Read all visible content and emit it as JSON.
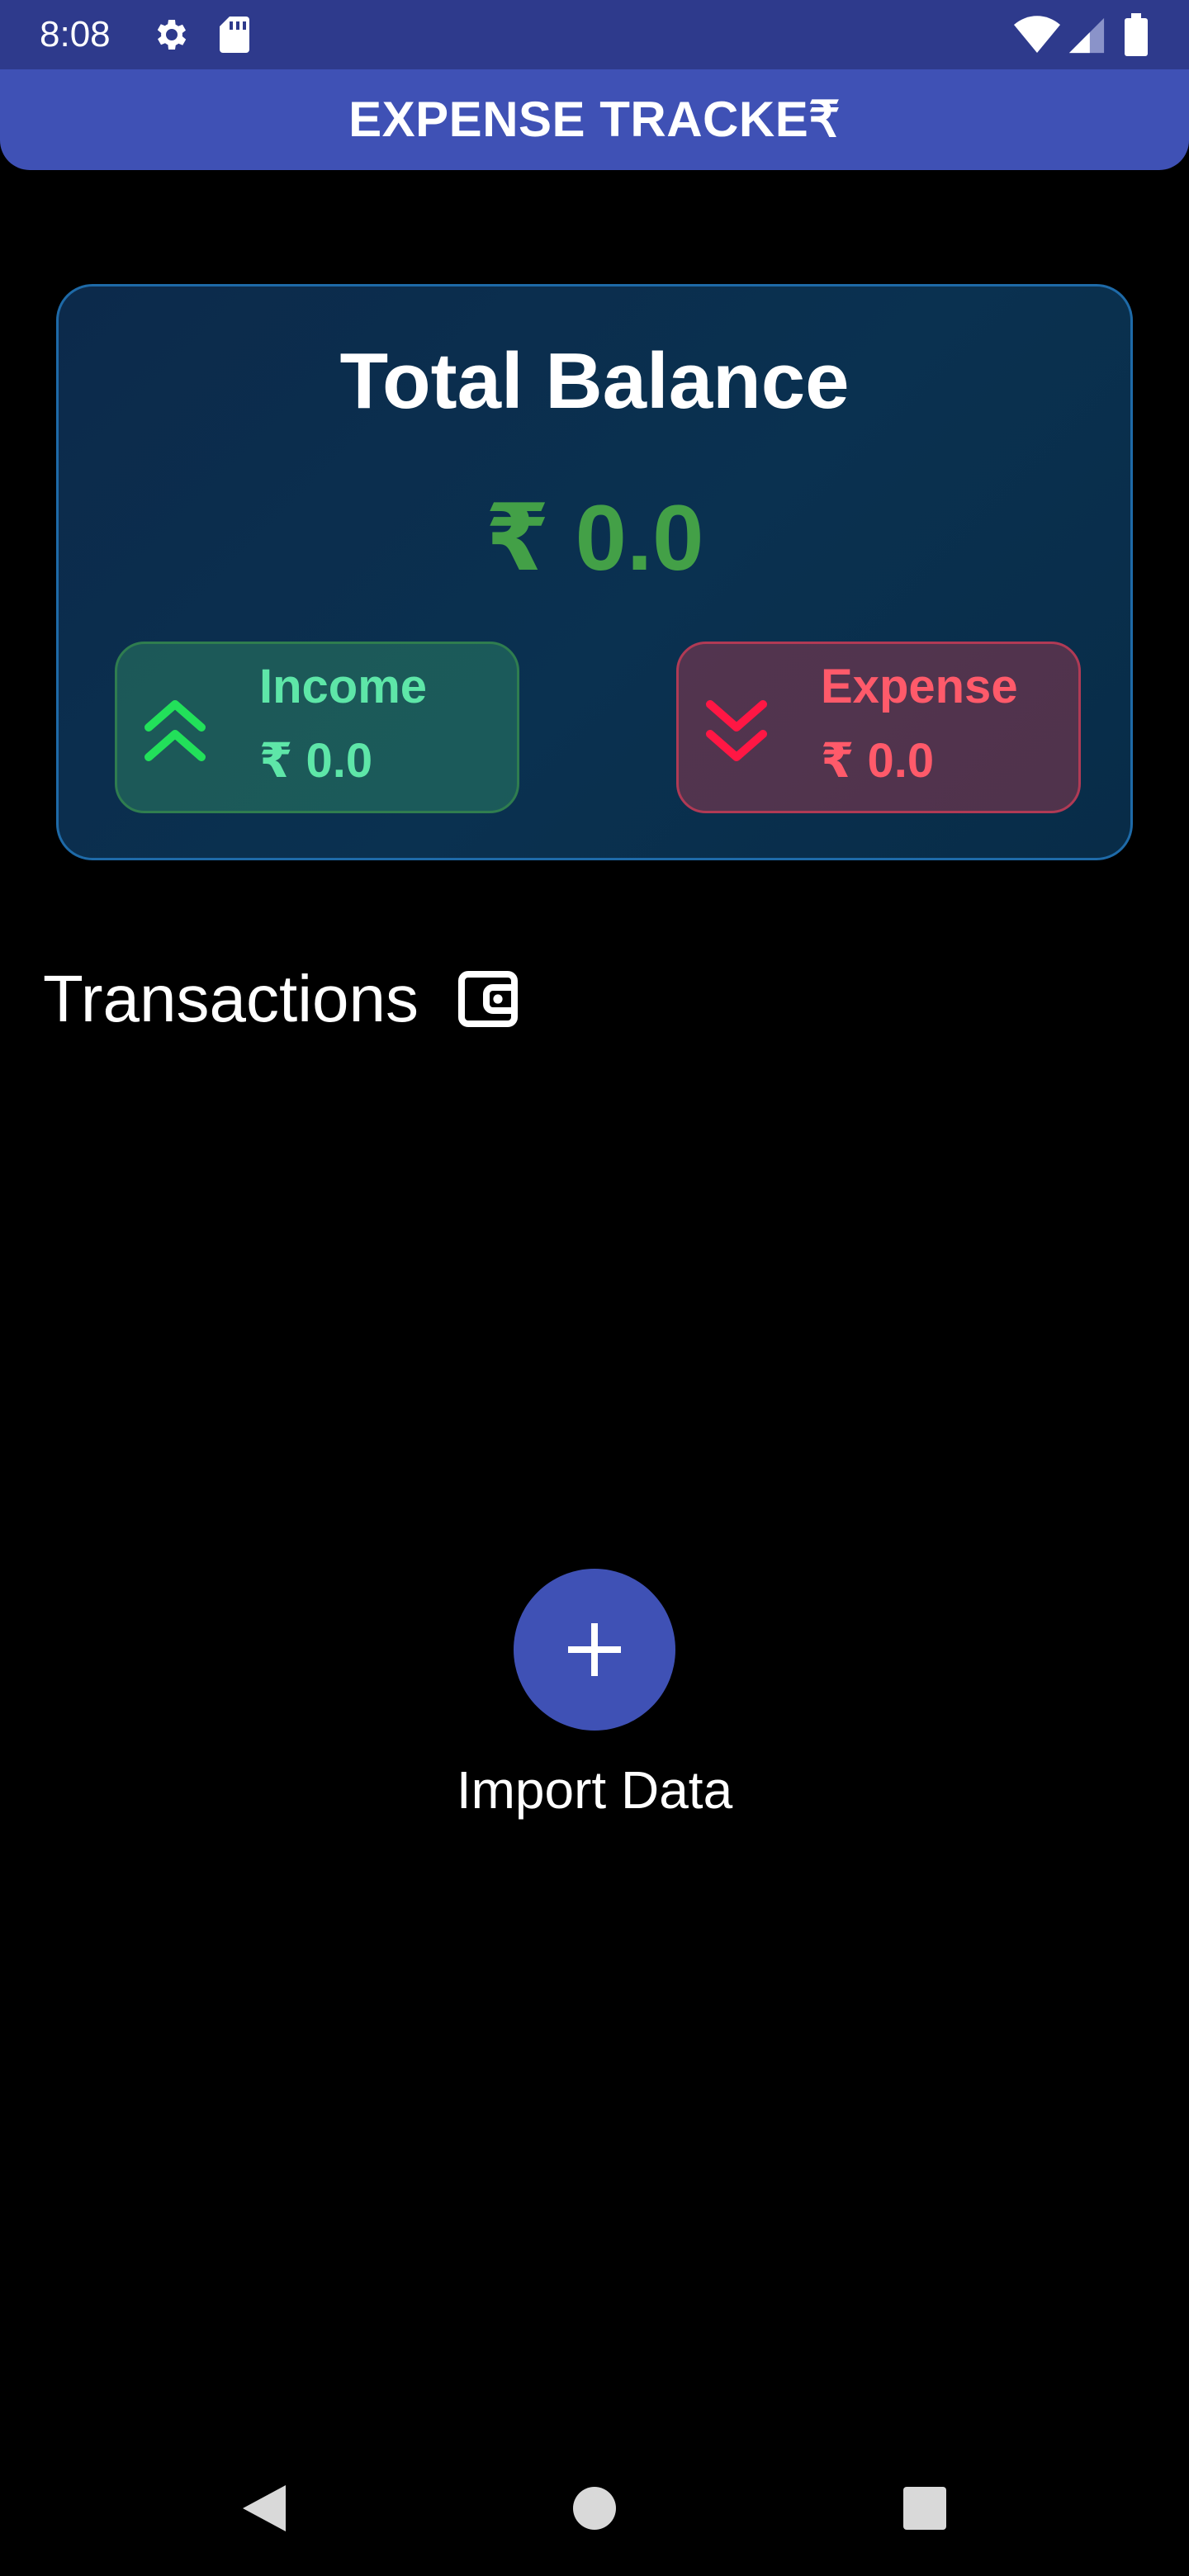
{
  "status_bar": {
    "time": "8:08",
    "icons": [
      "gear-icon",
      "sd-card-icon",
      "wifi-icon",
      "signal-icon",
      "battery-icon"
    ]
  },
  "app_bar": {
    "title": "EXPENSE TRACKE₹"
  },
  "balance": {
    "title": "Total Balance",
    "amount": "₹ 0.0",
    "income": {
      "label": "Income",
      "value": "₹ 0.0",
      "icon": "double-chevron-up-icon"
    },
    "expense": {
      "label": "Expense",
      "value": "₹ 0.0",
      "icon": "double-chevron-down-icon"
    }
  },
  "transactions": {
    "title": "Transactions",
    "icon": "wallet-icon"
  },
  "import": {
    "label": "Import Data",
    "icon": "plus-icon"
  },
  "nav": {
    "icons": [
      "back-icon",
      "home-icon",
      "recent-apps-icon"
    ]
  },
  "colors": {
    "status_bar": "#2e3a8c",
    "primary": "#3f51b5",
    "balance_amount": "#43a047",
    "income": "#5ee6a8",
    "income_icon": "#22e05a",
    "expense": "#ff5a6a",
    "expense_icon": "#ff1744",
    "card_border": "#1e6aa8",
    "background": "#000000"
  }
}
